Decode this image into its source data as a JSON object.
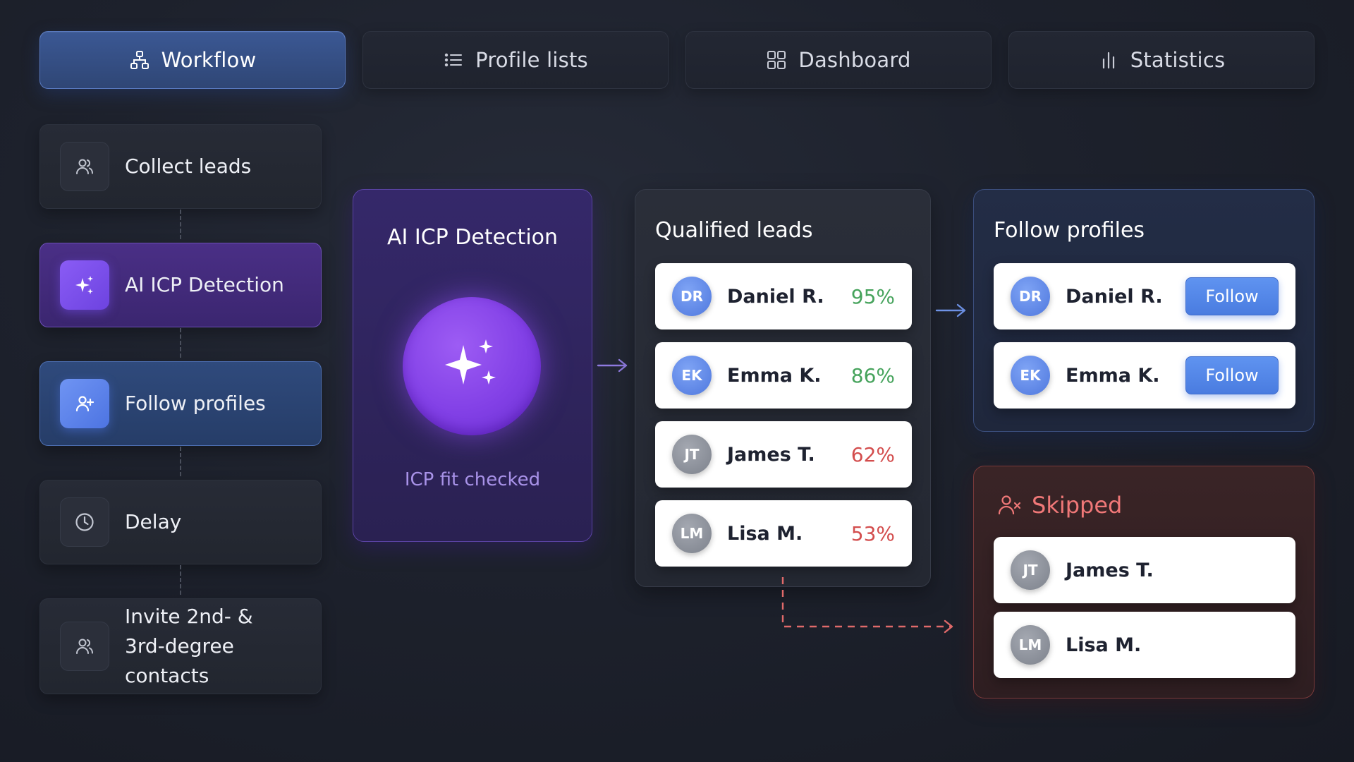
{
  "tabs": [
    {
      "label": "Workflow",
      "icon": "workflow-icon",
      "active": true
    },
    {
      "label": "Profile lists",
      "icon": "list-icon",
      "active": false
    },
    {
      "label": "Dashboard",
      "icon": "dashboard-grid-icon",
      "active": false
    },
    {
      "label": "Statistics",
      "icon": "bar-chart-icon",
      "active": false
    }
  ],
  "steps": [
    {
      "label": "Collect leads",
      "icon": "users-icon"
    },
    {
      "label": "AI ICP Detection",
      "icon": "sparkles-icon"
    },
    {
      "label": "Follow profiles",
      "icon": "user-plus-icon"
    },
    {
      "label": "Delay",
      "icon": "clock-icon"
    },
    {
      "label_line1": "Invite 2nd- &",
      "label_line2": "3rd-degree contacts",
      "icon": "users-icon"
    }
  ],
  "ai_panel": {
    "title": "AI ICP Detection",
    "caption": "ICP fit checked",
    "icon": "sparkles-icon"
  },
  "qualified": {
    "title": "Qualified leads",
    "leads": [
      {
        "initials": "DR",
        "name": "Daniel R.",
        "score": "95%",
        "status": "good"
      },
      {
        "initials": "EK",
        "name": "Emma K.",
        "score": "86%",
        "status": "good"
      },
      {
        "initials": "JT",
        "name": "James T.",
        "score": "62%",
        "status": "bad"
      },
      {
        "initials": "LM",
        "name": "Lisa M.",
        "score": "53%",
        "status": "bad"
      }
    ]
  },
  "follow": {
    "title": "Follow profiles",
    "button_label": "Follow",
    "profiles": [
      {
        "initials": "DR",
        "name": "Daniel R."
      },
      {
        "initials": "EK",
        "name": "Emma K."
      }
    ]
  },
  "skipped": {
    "title": "Skipped",
    "icon": "user-x-icon",
    "profiles": [
      {
        "initials": "JT",
        "name": "James T."
      },
      {
        "initials": "LM",
        "name": "Lisa M."
      }
    ]
  },
  "colors": {
    "accent_blue": "#4a7ce0",
    "accent_purple": "#8240e6",
    "score_good": "#46a35c",
    "score_bad": "#d34d4d",
    "skipped_red": "#f07878"
  }
}
